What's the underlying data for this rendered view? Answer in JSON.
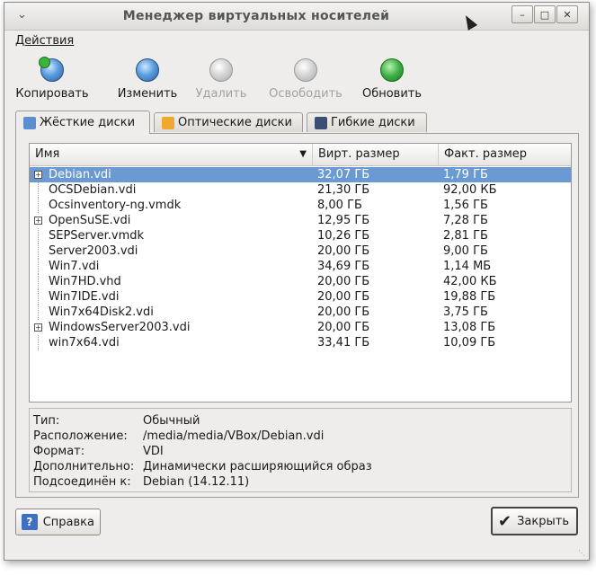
{
  "window": {
    "title": "Менеджер виртуальных носителей"
  },
  "menubar": {
    "actions": "Действия"
  },
  "toolbar": {
    "copy": "Копировать",
    "modify": "Изменить",
    "remove": "Удалить",
    "release": "Освободить",
    "refresh": "Обновить"
  },
  "tabs": {
    "hard": "Жёсткие диски",
    "optical": "Оптические диски",
    "floppy": "Гибкие диски"
  },
  "table": {
    "col_name": "Имя",
    "col_virtual": "Вирт. размер",
    "col_actual": "Факт. размер",
    "rows": [
      {
        "name": "Debian.vdi",
        "virtual": "32,07 ГБ",
        "actual": "1,79 ГБ"
      },
      {
        "name": "OCSDebian.vdi",
        "virtual": "21,30 ГБ",
        "actual": "92,00 КБ"
      },
      {
        "name": "Ocsinventory-ng.vmdk",
        "virtual": "8,00 ГБ",
        "actual": "1,56 ГБ"
      },
      {
        "name": "OpenSuSE.vdi",
        "virtual": "12,95 ГБ",
        "actual": "7,28 ГБ"
      },
      {
        "name": "SEPServer.vmdk",
        "virtual": "10,26 ГБ",
        "actual": "2,81 ГБ"
      },
      {
        "name": "Server2003.vdi",
        "virtual": "20,00 ГБ",
        "actual": "9,00 ГБ"
      },
      {
        "name": "Win7.vdi",
        "virtual": "34,69 ГБ",
        "actual": "1,14 МБ"
      },
      {
        "name": "Win7HD.vhd",
        "virtual": "20,00 ГБ",
        "actual": "42,00 КБ"
      },
      {
        "name": "Win7IDE.vdi",
        "virtual": "20,00 ГБ",
        "actual": "19,88 ГБ"
      },
      {
        "name": "Win7x64Disk2.vdi",
        "virtual": "20,00 ГБ",
        "actual": "3,75 ГБ"
      },
      {
        "name": "WindowsServer2003.vdi",
        "virtual": "20,00 ГБ",
        "actual": "13,08 ГБ"
      },
      {
        "name": "win7x64.vdi",
        "virtual": "33,41 ГБ",
        "actual": "10,09 ГБ"
      }
    ]
  },
  "info": {
    "type_label": "Тип:",
    "type_value": "Обычный",
    "location_label": "Расположение:",
    "location_value": "/media/media/VBox/Debian.vdi",
    "format_label": "Формат:",
    "format_value": "VDI",
    "details_label": "Дополнительно:",
    "details_value": "Динамически расширяющийся образ",
    "attached_label": "Подсоединён к:",
    "attached_value": "Debian (14.12.11)"
  },
  "buttons": {
    "help": "Справка",
    "close": "Закрыть"
  }
}
